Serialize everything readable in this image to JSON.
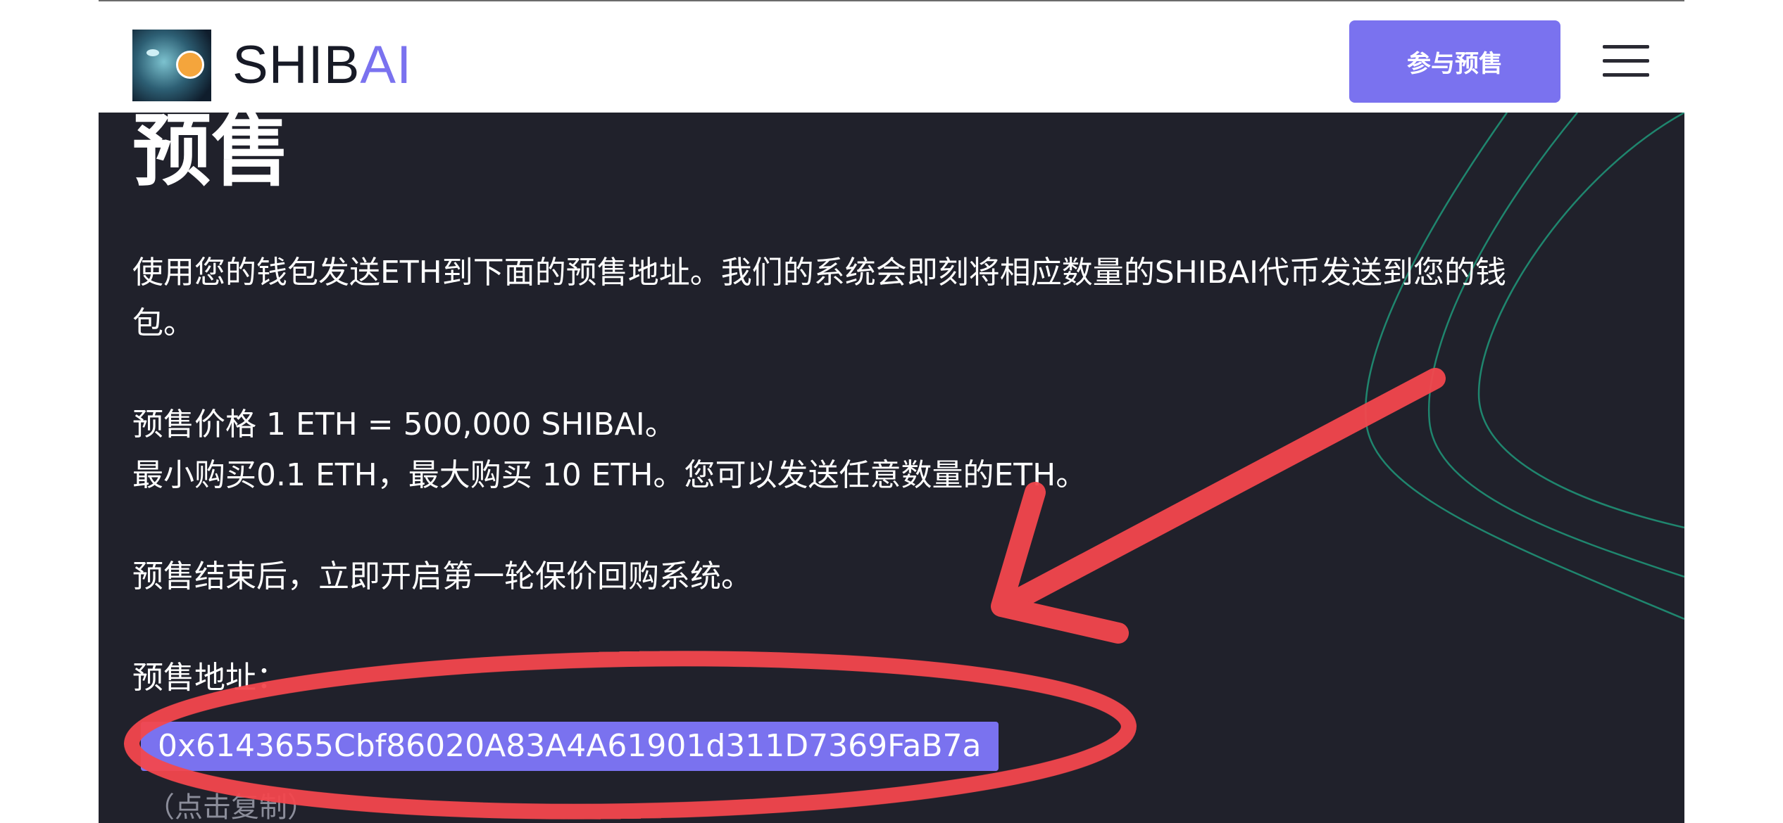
{
  "header": {
    "brand_prefix": "SHIB",
    "brand_suffix": "AI",
    "cta_label": "参与预售",
    "menu_icon": "hamburger-icon"
  },
  "presale": {
    "title": "预售",
    "intro_line1": "使用您的钱包发送ETH到下面的预售地址。我们的系统会即刻将相应数量的SHIBAI代币发送到您的钱",
    "intro_line2": "包。",
    "price": "预售价格 1 ETH = 500,000 SHIBAI。",
    "limits": "最小购买0.1 ETH，最大购买 10 ETH。您可以发送任意数量的ETH。",
    "after_sale": "预售结束后，立即开启第一轮保价回购系统。",
    "address_label": "预售地址：",
    "address": "0x6143655Cbf86020A83A4A61901d311D7369FaB7a",
    "copy_hint": "（点击复制）"
  },
  "colors": {
    "accent": "#7a72ef",
    "background": "#20212b",
    "annotation_red": "#f4474d",
    "deco_line": "#1fa886"
  }
}
